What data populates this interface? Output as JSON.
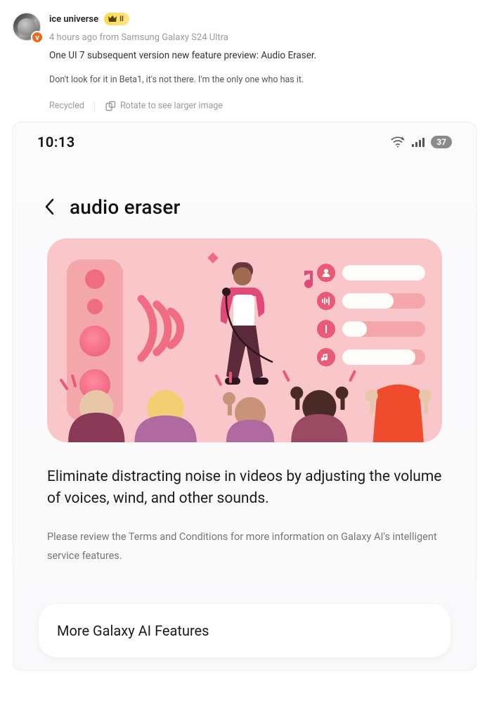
{
  "post": {
    "username": "ice universe",
    "verified_letter": "v",
    "crown_label": "II",
    "meta": "4 hours ago from Samsung Galaxy S24 Ultra",
    "title": "One UI 7 subsequent version new feature preview: Audio Eraser.",
    "body": "Don't look for it in Beta1, it's not there. I'm the only one who has it.",
    "recycled_label": "Recycled",
    "rotate_label": "Rotate to see larger image"
  },
  "phone": {
    "status": {
      "time": "10:13",
      "battery": "37"
    },
    "header": {
      "title": "audio eraser"
    },
    "description": "Eliminate distracting noise in videos by adjusting the volume of voices, wind, and other sounds.",
    "terms": "Please review the Terms and Conditions for more information on Galaxy AI's intelligent service features.",
    "more_card": "More Galaxy AI Features",
    "sliders": [
      {
        "icon": "person-icon",
        "fill": 100
      },
      {
        "icon": "waveform-icon",
        "fill": 62
      },
      {
        "icon": "bar-icon",
        "fill": 30
      },
      {
        "icon": "music-note-icon",
        "fill": 88
      }
    ]
  }
}
